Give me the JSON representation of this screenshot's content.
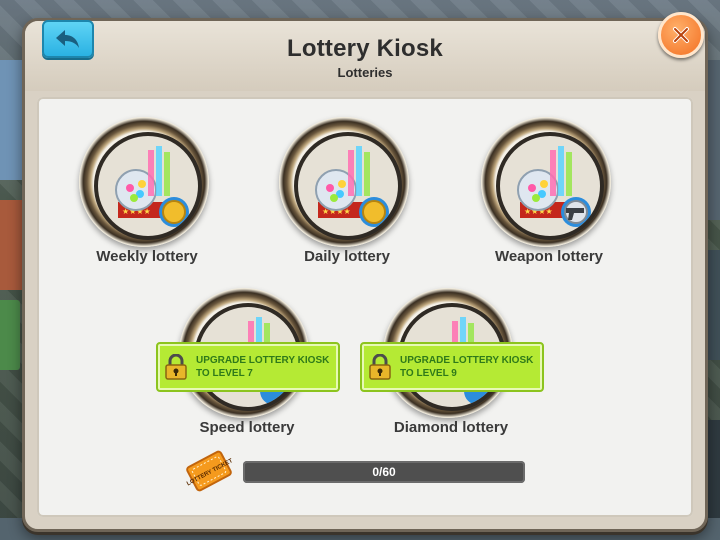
{
  "window": {
    "title": "Lottery Kiosk",
    "subtitle": "Lotteries"
  },
  "lotteries": [
    {
      "label": "Weekly lottery",
      "badge_icon": "gold-coin-icon",
      "locked": false
    },
    {
      "label": "Daily lottery",
      "badge_icon": "gold-coin-icon",
      "locked": false
    },
    {
      "label": "Weapon lottery",
      "badge_icon": "pistol-icon",
      "locked": false
    },
    {
      "label": "Speed lottery",
      "locked": true,
      "lock_line1": "UPGRADE LOTTERY KIOSK",
      "lock_line2": "TO LEVEL 7"
    },
    {
      "label": "Diamond lottery",
      "locked": true,
      "lock_line1": "UPGRADE LOTTERY KIOSK",
      "lock_line2": "TO LEVEL 9"
    }
  ],
  "tickets": {
    "progress_text": "0/60",
    "current": 0,
    "max": 60,
    "ticket_icon": "lottery-ticket-icon",
    "ticket_word": "LOTTERY TICKET"
  },
  "colors": {
    "back_button": "#2ab2e3",
    "close_button": "#f36f22",
    "lock_banner": "#b5ea34",
    "lock_text": "#2f7a1a"
  }
}
